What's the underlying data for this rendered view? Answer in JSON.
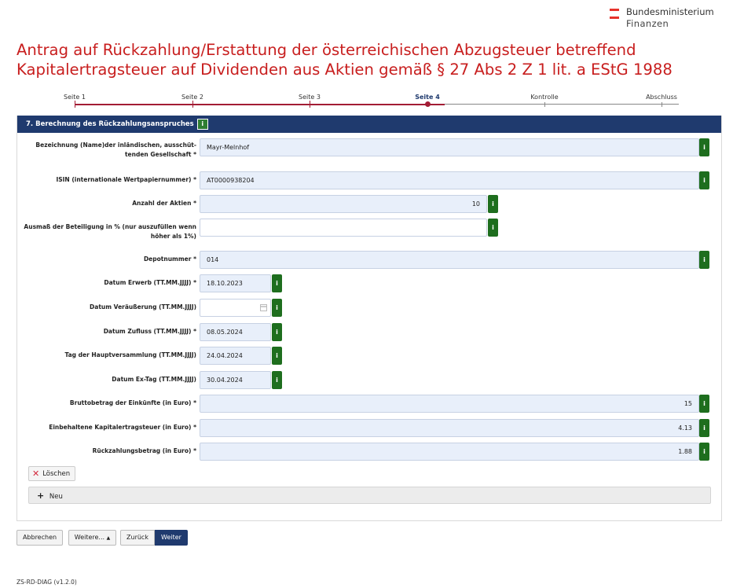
{
  "header": {
    "ministry_line1": "Bundesministerium",
    "ministry_line2": "Finanzen",
    "title": "Antrag auf Rückzahlung/Erstattung der österreichischen Abzugsteuer betreffend Kapitalertragsteuer auf Dividenden aus Aktien gemäß § 27 Abs 2 Z 1 lit. a EStG 1988"
  },
  "steps": [
    {
      "label": "Seite 1",
      "active": false
    },
    {
      "label": "Seite 2",
      "active": false
    },
    {
      "label": "Seite 3",
      "active": false
    },
    {
      "label": "Seite 4",
      "active": true
    },
    {
      "label": "Kontrolle",
      "active": false
    },
    {
      "label": "Abschluss",
      "active": false
    }
  ],
  "section": {
    "title": "7. Berechnung des Rückzahlungsanspruches",
    "info": "i"
  },
  "fields": [
    {
      "label": "Bezeichnung (Name)der inländischen, ausschüt-tenden Gesellschaft *",
      "value": "Mayr-Melnhof",
      "info": "i"
    },
    {
      "label": "ISIN (internationale Wertpapiernummer) *",
      "value": "AT0000938204",
      "info": "i"
    },
    {
      "label": "Anzahl der Aktien *",
      "value": "10",
      "info": "i"
    },
    {
      "label": "Ausmaß der Beteiligung in % (nur auszufüllen wenn höher als 1%)",
      "value": "",
      "info": "i"
    },
    {
      "label": "Depotnummer *",
      "value": "014",
      "info": "i"
    },
    {
      "label": "Datum Erwerb (TT.MM.JJJJ) *",
      "value": "18.10.2023",
      "info": "i"
    },
    {
      "label": "Datum Veräußerung (TT.MM.JJJJ)",
      "value": "",
      "info": "i"
    },
    {
      "label": "Datum Zufluss (TT.MM.JJJJ) *",
      "value": "08.05.2024",
      "info": "i"
    },
    {
      "label": "Tag der Hauptversammlung (TT.MM.JJJJ)",
      "value": "24.04.2024",
      "info": "i"
    },
    {
      "label": "Datum Ex-Tag (TT.MM.JJJJ)",
      "value": "30.04.2024",
      "info": "i"
    },
    {
      "label": "Bruttobetrag der Einkünfte (in Euro) *",
      "value": "15",
      "info": "i"
    },
    {
      "label": "Einbehaltene Kapitalertragsteuer (in Euro) *",
      "value": "4.13",
      "info": "i"
    },
    {
      "label": "Rückzahlungsbetrag (in Euro) *",
      "value": "1.88",
      "info": "i"
    }
  ],
  "actions": {
    "delete": "Löschen",
    "new": "Neu"
  },
  "nav": {
    "cancel": "Abbrechen",
    "more": "Weitere...",
    "back": "Zurück",
    "next": "Weiter"
  },
  "footer": "ZS-RD-DIAG (v1.2.0)",
  "colors": {
    "title_red": "#c81e1e",
    "primary_blue": "#1f3a6e",
    "info_green": "#1e6e1e"
  }
}
